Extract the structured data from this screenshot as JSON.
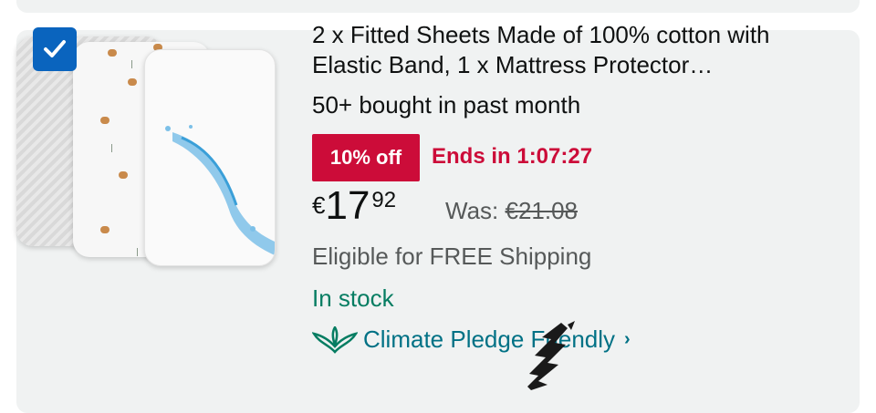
{
  "product": {
    "selected": true,
    "title": "2 x Fitted Sheets Made of 100% cotton with Elastic Band, 1 x Mattress Protector…",
    "bought": "50+ bought in past month",
    "deal": {
      "badge": "10% off",
      "ends": "Ends in 1:07:27"
    },
    "price": {
      "symbol": "€",
      "whole": "17",
      "fraction": "92"
    },
    "was": {
      "label": "Was: ",
      "value": "€21.08"
    },
    "shipping": "Eligible for FREE Shipping",
    "stock": "In stock",
    "climate": {
      "label": "Climate Pledge Friendly",
      "icon": "climate-pledge-icon"
    }
  },
  "colors": {
    "card_bg": "#f0f2f2",
    "checkbox": "#0a64be",
    "deal_red": "#cc0c39",
    "stock_green": "#067d62",
    "link_teal": "#007185"
  }
}
